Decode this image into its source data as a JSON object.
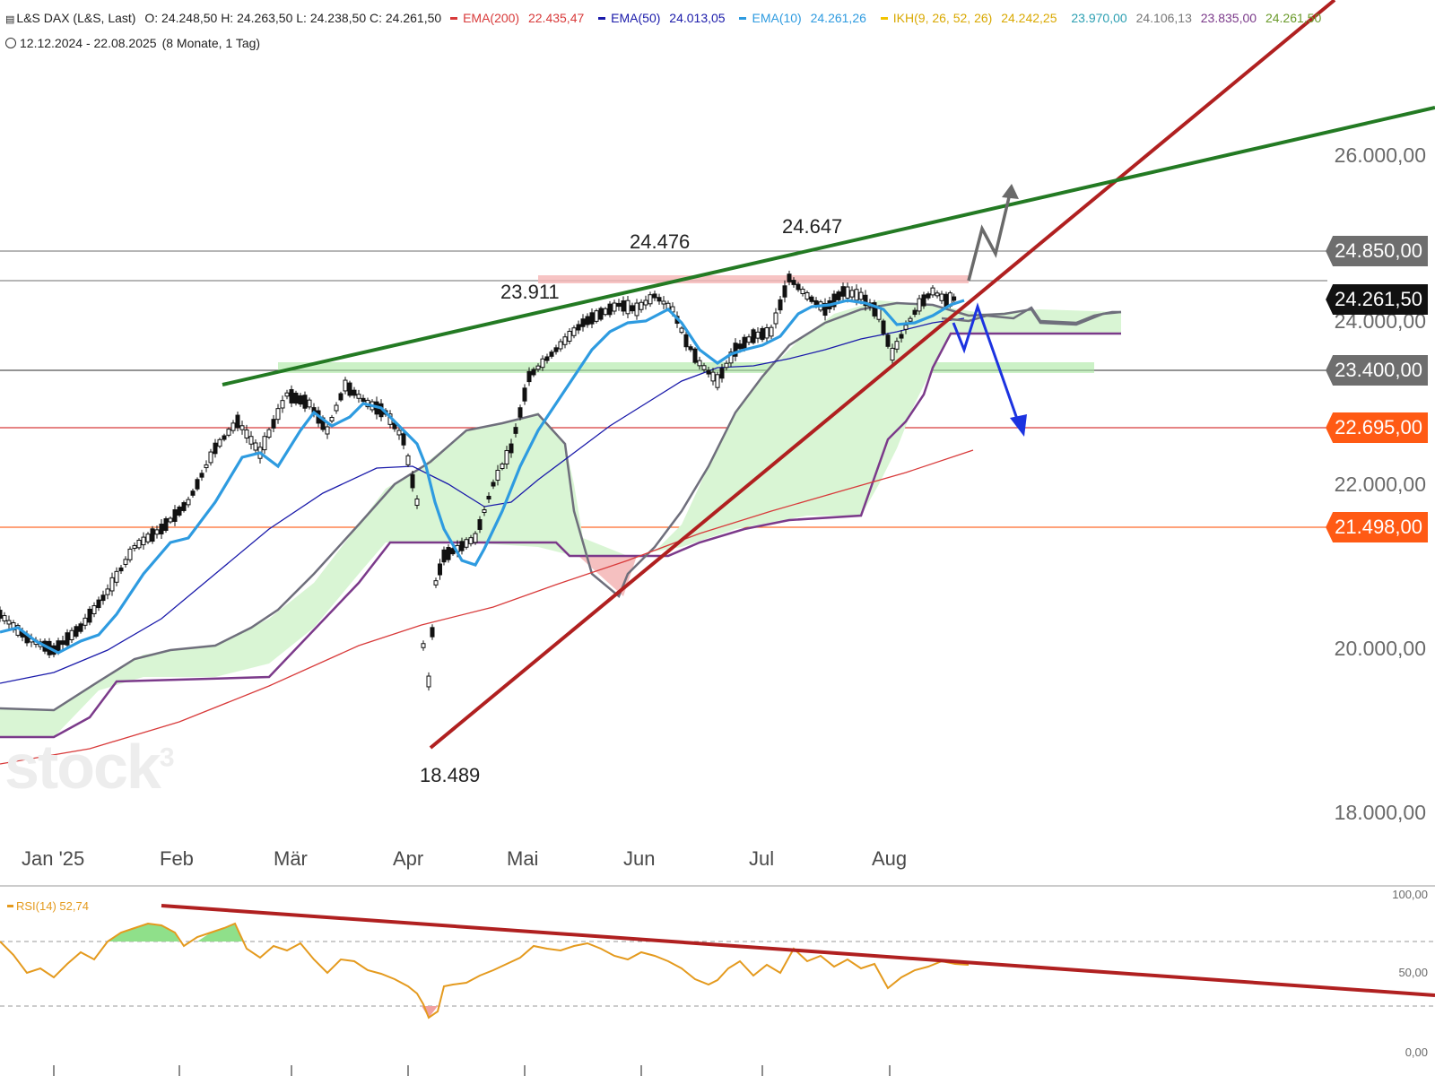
{
  "header": {
    "symbol": "L&S DAX (L&S, Last)",
    "ohlc": "O: 24.248,50  H: 24.263,50  L: 24.238,50  C: 24.261,50",
    "indicators": [
      {
        "label": "EMA(200)",
        "value": "22.435,47",
        "color": "#d83a3a"
      },
      {
        "label": "EMA(50)",
        "value": "24.013,05",
        "color": "#1a1aaa"
      },
      {
        "label": "EMA(10)",
        "value": "24.261,26",
        "color": "#2e9be0"
      },
      {
        "label": "IKH(9, 26, 52, 26)",
        "value": "24.242,25",
        "color": "#f2c400"
      }
    ],
    "ikh_values": [
      {
        "value": "23.970,00",
        "color": "#2b9fb2"
      },
      {
        "value": "24.106,13",
        "color": "#777777"
      },
      {
        "value": "23.835,00",
        "color": "#7b3a8a"
      },
      {
        "value": "24.261,50",
        "color": "#6a9a2a"
      }
    ],
    "range": "12.12.2024 - 22.08.2025",
    "period": "(8 Monate, 1 Tag)"
  },
  "watermark": "stock3",
  "price_axis": [
    "26.000,00",
    "24.000,00",
    "22.000,00",
    "20.000,00",
    "18.000,00"
  ],
  "price_tags": [
    {
      "text": "24.850,00",
      "color": "#6e6e6e"
    },
    {
      "text": "24.261,50",
      "color": "#111111"
    },
    {
      "text": "23.400,00",
      "color": "#6e6e6e"
    },
    {
      "text": "22.695,00",
      "color": "#ff5a14"
    },
    {
      "text": "21.498,00",
      "color": "#ff5a14"
    }
  ],
  "months": [
    "Jan '25",
    "Feb",
    "Mär",
    "Apr",
    "Mai",
    "Jun",
    "Jul",
    "Aug"
  ],
  "annotations": {
    "high1": "24.476",
    "high2": "24.647",
    "level": "23.911",
    "low": "18.489"
  },
  "rsi": {
    "label": "RSI(14)",
    "value": "52,74",
    "axis": [
      "100,00",
      "50,00",
      "0,00"
    ]
  },
  "colors": {
    "ema10": "#2e9be0",
    "ema50": "#1a1aaa",
    "ema200": "#d83a3a",
    "trend_up": "#b02020",
    "channel": "#237a23",
    "cloud": "#d9f5d4",
    "rsi": "#e49a1e"
  }
}
